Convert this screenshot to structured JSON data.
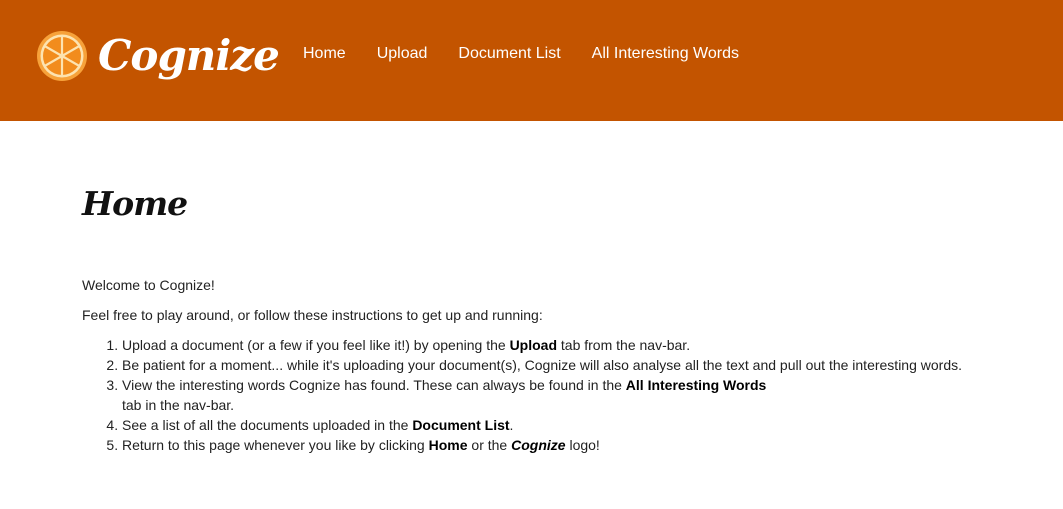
{
  "brand": {
    "name": "Cognize",
    "logo_icon": "orange-slice-icon",
    "colors": {
      "navbar": "#c35400",
      "orange": "#f28c1d",
      "orange_light": "#fbb040"
    }
  },
  "nav": {
    "items": [
      "Home",
      "Upload",
      "Document List",
      "All Interesting Words"
    ]
  },
  "page": {
    "title": "Home",
    "welcome": "Welcome to Cognize!",
    "intro": "Feel free to play around, or follow these instructions to get up and running:",
    "steps": [
      {
        "pre": "Upload a document (or a few if you feel like it!) by opening the ",
        "bold": "Upload",
        "post": " tab from the nav-bar."
      },
      {
        "text": "Be patient for a moment... while it's uploading your document(s), Cognize will also analyse all the text and pull out the interesting words."
      },
      {
        "pre": "View the interesting words Cognize has found. These can always be found in the ",
        "bold": "All Interesting Words",
        "post": "tab in the nav-bar."
      },
      {
        "pre": "See a list of all the documents uploaded in the ",
        "bold": "Document List",
        "post": "."
      },
      {
        "pre": "Return to this page whenever you like by clicking ",
        "bold": "Home",
        "mid": " or the ",
        "bold_italic": "Cognize",
        "post": " logo!"
      }
    ]
  }
}
